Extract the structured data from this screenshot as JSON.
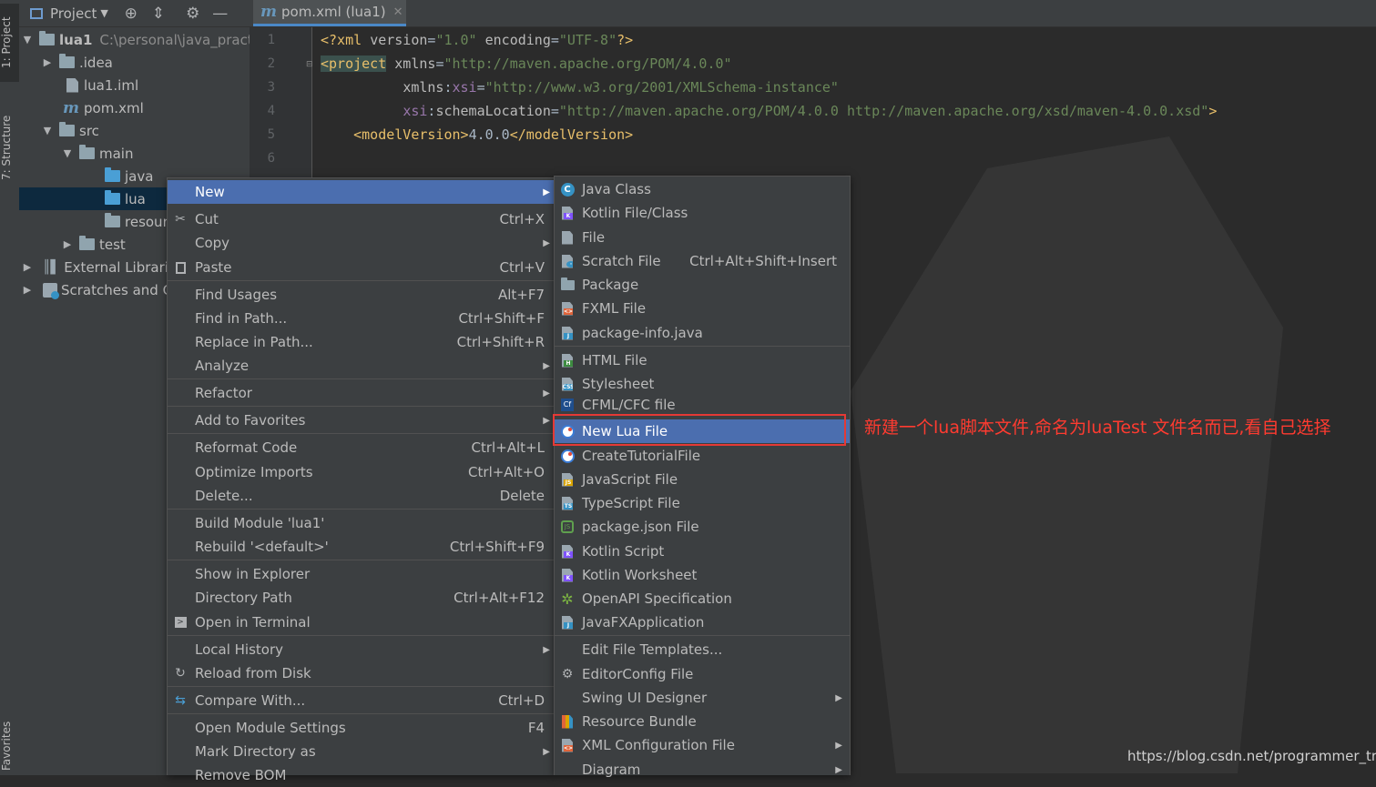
{
  "left_strip": {
    "project_tab": "1: Project",
    "structure_tab": "7: Structure",
    "favorites_tab": "Favorites"
  },
  "project_panel": {
    "title": "Project",
    "tree": [
      {
        "label": "lua1",
        "extra": "C:\\personal\\java_practi",
        "icon": "module-folder-icon",
        "expanded": true
      },
      {
        "label": ".idea",
        "icon": "folder-icon",
        "expanded": false
      },
      {
        "label": "lua1.iml",
        "icon": "iml-file-icon"
      },
      {
        "label": "pom.xml",
        "icon": "maven-icon"
      },
      {
        "label": "src",
        "icon": "folder-icon",
        "expanded": true
      },
      {
        "label": "main",
        "icon": "folder-icon",
        "expanded": true
      },
      {
        "label": "java",
        "icon": "source-folder-icon"
      },
      {
        "label": "lua",
        "icon": "source-folder-icon",
        "selected": true
      },
      {
        "label": "resour",
        "icon": "resources-folder-icon"
      },
      {
        "label": "test",
        "icon": "folder-icon",
        "expanded": false
      },
      {
        "label": "External Librarie",
        "icon": "libraries-icon",
        "expanded": false
      },
      {
        "label": "Scratches and C",
        "icon": "scratches-icon",
        "expanded": false
      }
    ]
  },
  "editor": {
    "tab_label": "pom.xml (lua1)",
    "line_numbers": [
      "1",
      "2",
      "3",
      "4",
      "5",
      "6"
    ],
    "lines": {
      "l1": {
        "open": "<?xml ",
        "a1": "version",
        "eq1": "=",
        "v1": "\"1.0\"",
        "a2": " encoding",
        "eq2": "=",
        "v2": "\"UTF-8\"",
        "close": "?>"
      },
      "l2": {
        "tag": "<project",
        "a1": " xmlns",
        "eq1": "=",
        "v1": "\"http://maven.apache.org/POM/4.0.0\""
      },
      "l3": {
        "indent": "          ",
        "a1": "xmlns",
        "colon": ":",
        "ns": "xsi",
        "eq1": "=",
        "v1": "\"http://www.w3.org/2001/XMLSchema-instance\""
      },
      "l4": {
        "indent": "          ",
        "ns": "xsi",
        "colon": ":",
        "a1": "schemaLocation",
        "eq1": "=",
        "v1": "\"http://maven.apache.org/POM/4.0.0 http://maven.apache.org/xsd/maven-4.0.0.xsd\"",
        "close": ">"
      },
      "l5": {
        "indent": "    ",
        "t1": "<modelVersion>",
        "text": "4.0.0",
        "t2": "</modelVersion>"
      }
    }
  },
  "context_menu": {
    "items": [
      {
        "label": "New",
        "submenu": true,
        "highlighted": true
      },
      {
        "label": "Cut",
        "shortcut": "Ctrl+X",
        "icon": "scissors-icon"
      },
      {
        "label": "Copy",
        "submenu": true
      },
      {
        "label": "Paste",
        "shortcut": "Ctrl+V",
        "icon": "clipboard-icon"
      },
      {
        "label": "Find Usages",
        "shortcut": "Alt+F7"
      },
      {
        "label": "Find in Path...",
        "shortcut": "Ctrl+Shift+F"
      },
      {
        "label": "Replace in Path...",
        "shortcut": "Ctrl+Shift+R"
      },
      {
        "label": "Analyze",
        "submenu": true
      },
      {
        "label": "Refactor",
        "submenu": true
      },
      {
        "label": "Add to Favorites",
        "submenu": true
      },
      {
        "label": "Reformat Code",
        "shortcut": "Ctrl+Alt+L"
      },
      {
        "label": "Optimize Imports",
        "shortcut": "Ctrl+Alt+O"
      },
      {
        "label": "Delete...",
        "shortcut": "Delete"
      },
      {
        "label": "Build Module 'lua1'"
      },
      {
        "label": "Rebuild '<default>'",
        "shortcut": "Ctrl+Shift+F9"
      },
      {
        "label": "Show in Explorer"
      },
      {
        "label": "Directory Path",
        "shortcut": "Ctrl+Alt+F12"
      },
      {
        "label": "Open in Terminal",
        "icon": "terminal-icon"
      },
      {
        "label": "Local History",
        "submenu": true
      },
      {
        "label": "Reload from Disk",
        "icon": "reload-icon"
      },
      {
        "label": "Compare With...",
        "shortcut": "Ctrl+D",
        "icon": "compare-icon"
      },
      {
        "label": "Open Module Settings",
        "shortcut": "F4"
      },
      {
        "label": "Mark Directory as",
        "submenu": true
      },
      {
        "label": "Remove BOM"
      }
    ]
  },
  "new_submenu": {
    "items": [
      {
        "label": "Java Class",
        "icon": "java-class-icon"
      },
      {
        "label": "Kotlin File/Class",
        "icon": "kotlin-file-icon"
      },
      {
        "label": "File",
        "icon": "file-icon"
      },
      {
        "label": "Scratch File",
        "shortcut": "Ctrl+Alt+Shift+Insert",
        "icon": "scratch-file-icon"
      },
      {
        "label": "Package",
        "icon": "package-icon"
      },
      {
        "label": "FXML File",
        "icon": "fxml-file-icon"
      },
      {
        "label": "package-info.java",
        "icon": "package-info-icon"
      },
      {
        "label": "HTML File",
        "icon": "html-file-icon"
      },
      {
        "label": "Stylesheet",
        "icon": "css-file-icon"
      },
      {
        "label": "CFML/CFC file",
        "icon": "cfml-file-icon"
      },
      {
        "label": "New Lua File",
        "icon": "lua-file-icon",
        "highlighted": true
      },
      {
        "label": "CreateTutorialFile",
        "icon": "lua-file-icon"
      },
      {
        "label": "JavaScript File",
        "icon": "javascript-file-icon"
      },
      {
        "label": "TypeScript File",
        "icon": "typescript-file-icon"
      },
      {
        "label": "package.json File",
        "icon": "nodejs-icon"
      },
      {
        "label": "Kotlin Script",
        "icon": "kotlin-script-icon"
      },
      {
        "label": "Kotlin Worksheet",
        "icon": "kotlin-worksheet-icon"
      },
      {
        "label": "OpenAPI Specification",
        "icon": "openapi-icon"
      },
      {
        "label": "JavaFXApplication",
        "icon": "javafx-icon"
      },
      {
        "label": "Edit File Templates...",
        "icon": ""
      },
      {
        "label": "EditorConfig File",
        "icon": "gear-icon"
      },
      {
        "label": "Swing UI Designer",
        "submenu": true
      },
      {
        "label": "Resource Bundle",
        "icon": "resource-bundle-icon"
      },
      {
        "label": "XML Configuration File",
        "submenu": true,
        "icon": "xml-config-icon"
      },
      {
        "label": "Diagram",
        "submenu": true
      }
    ]
  },
  "annotation": {
    "text": "新建一个lua脚本文件,命名为luaTest   文件名而已,看自己选择",
    "color": "#ff3b30"
  },
  "credit": "https://blog.csdn.net/programmer_trip",
  "colors": {
    "menu_bg": "#3c3f41",
    "highlight": "#4b6eaf",
    "editor_bg": "#2b2b2b",
    "selection": "#0d293e"
  }
}
